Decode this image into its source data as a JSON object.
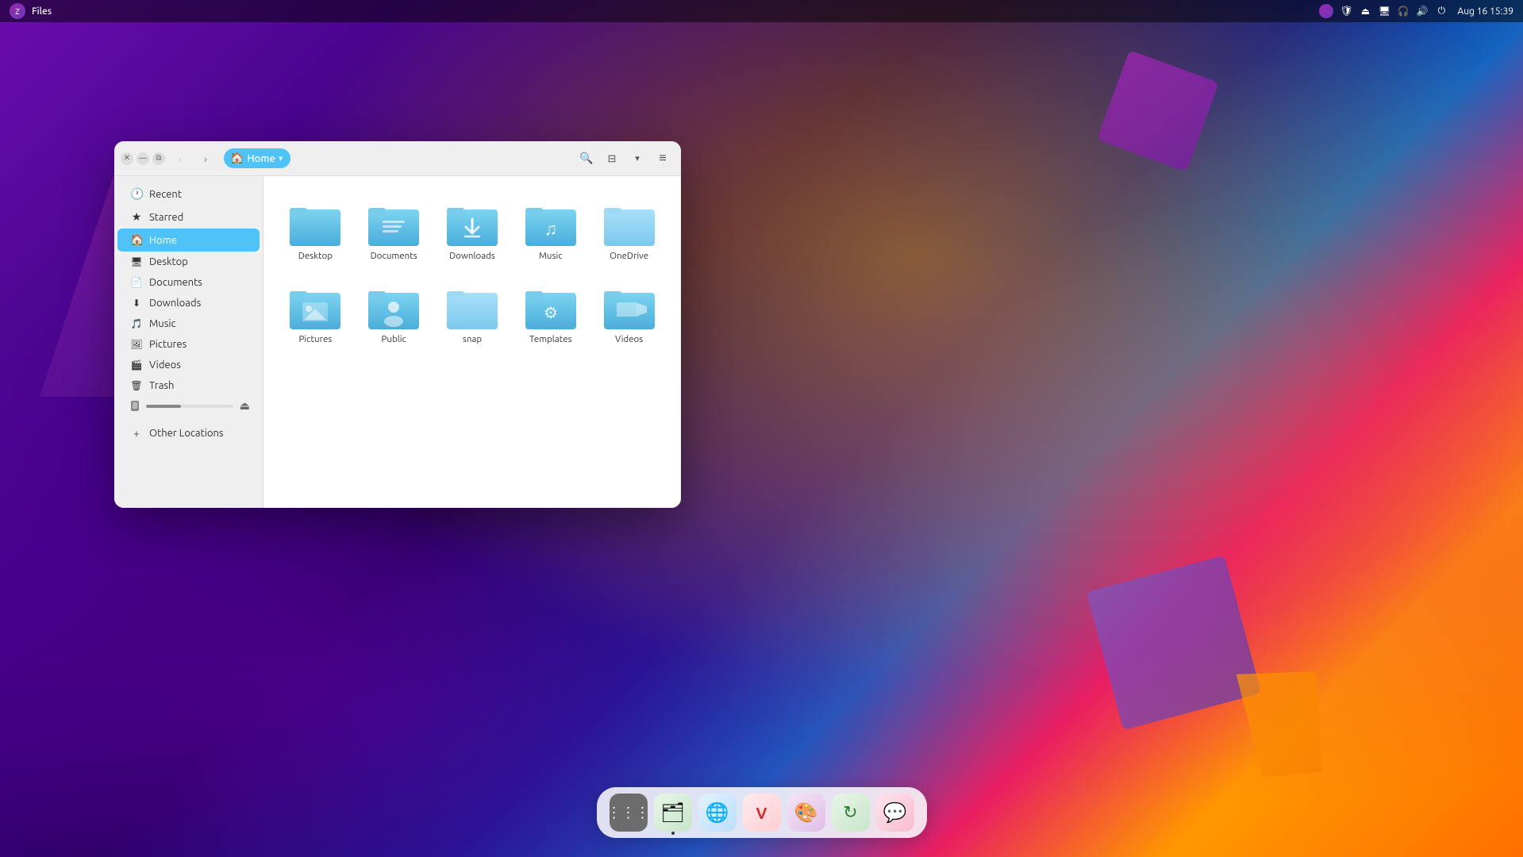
{
  "desktop": {
    "bg_gradient": "purple-blue-orange"
  },
  "topbar": {
    "app_name": "Files",
    "datetime": "Aug 16  15:39",
    "icons": [
      "activities",
      "files-indicator",
      "shield",
      "eject",
      "screen",
      "headphone",
      "volume",
      "power"
    ]
  },
  "window": {
    "title": "Home",
    "location": "Home",
    "location_icon": "🏠",
    "buttons": {
      "close": "✕",
      "minimize": "—",
      "restore": "⧉"
    },
    "nav": {
      "back": "‹",
      "forward": "›"
    },
    "actions": {
      "search": "🔍",
      "view_list": "☰",
      "view_options": "▾",
      "menu": "≡"
    }
  },
  "sidebar": {
    "items": [
      {
        "id": "recent",
        "label": "Recent",
        "icon": "🕐",
        "active": false
      },
      {
        "id": "starred",
        "label": "Starred",
        "icon": "★",
        "active": false
      },
      {
        "id": "home",
        "label": "Home",
        "icon": "🏠",
        "active": true
      },
      {
        "id": "desktop",
        "label": "Desktop",
        "icon": "🖥",
        "active": false
      },
      {
        "id": "documents",
        "label": "Documents",
        "icon": "📄",
        "active": false
      },
      {
        "id": "downloads",
        "label": "Downloads",
        "icon": "⬇",
        "active": false
      },
      {
        "id": "music",
        "label": "Music",
        "icon": "🎵",
        "active": false
      },
      {
        "id": "pictures",
        "label": "Pictures",
        "icon": "🖼",
        "active": false
      },
      {
        "id": "videos",
        "label": "Videos",
        "icon": "🎬",
        "active": false
      },
      {
        "id": "trash",
        "label": "Trash",
        "icon": "🗑",
        "active": false
      }
    ],
    "drive": {
      "label": "",
      "percent": 40,
      "eject_icon": "⏏"
    },
    "other_locations": {
      "label": "Other Locations",
      "icon": "+"
    }
  },
  "files": [
    {
      "id": "desktop",
      "name": "Desktop",
      "type": "folder",
      "color": "blue",
      "icon_type": "default"
    },
    {
      "id": "documents",
      "name": "Documents",
      "type": "folder",
      "color": "blue",
      "icon_type": "default"
    },
    {
      "id": "downloads",
      "name": "Downloads",
      "type": "folder",
      "color": "blue",
      "icon_type": "download"
    },
    {
      "id": "music",
      "name": "Music",
      "type": "folder",
      "color": "blue",
      "icon_type": "music"
    },
    {
      "id": "onedrive",
      "name": "OneDrive",
      "type": "folder",
      "color": "light",
      "icon_type": "default"
    },
    {
      "id": "pictures",
      "name": "Pictures",
      "type": "folder",
      "color": "blue",
      "icon_type": "pictures"
    },
    {
      "id": "public",
      "name": "Public",
      "type": "folder",
      "color": "blue",
      "icon_type": "person"
    },
    {
      "id": "snap",
      "name": "snap",
      "type": "folder",
      "color": "light",
      "icon_type": "default"
    },
    {
      "id": "templates",
      "name": "Templates",
      "type": "folder",
      "color": "blue",
      "icon_type": "templates"
    },
    {
      "id": "videos",
      "name": "Videos",
      "type": "folder",
      "color": "blue",
      "icon_type": "video"
    }
  ],
  "dock": {
    "items": [
      {
        "id": "apps",
        "label": "App Grid",
        "icon": "⋮⋮⋮"
      },
      {
        "id": "files",
        "label": "Files",
        "icon": "🗂",
        "active": true
      },
      {
        "id": "browser",
        "label": "Browser",
        "icon": "🌐"
      },
      {
        "id": "vivaldi",
        "label": "Vivaldi",
        "icon": "V"
      },
      {
        "id": "colors",
        "label": "Colors",
        "icon": "🎨"
      },
      {
        "id": "update",
        "label": "Update",
        "icon": "↻"
      },
      {
        "id": "chat",
        "label": "Chat",
        "icon": "💬"
      }
    ]
  }
}
